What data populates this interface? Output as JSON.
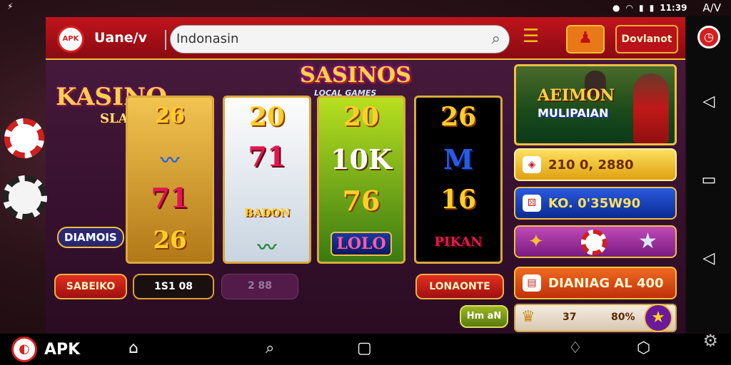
{
  "statusbar": {
    "left_icon": "usb-icon",
    "time": "11:39",
    "carrier": "A/V",
    "icons": [
      "notification-icon",
      "wifi-icon",
      "signal-icon",
      "battery-icon"
    ]
  },
  "header": {
    "logo_text": "APK",
    "app_name": "Uane/v",
    "search_value": "Indonasin",
    "download_label": "Dovlanot"
  },
  "game": {
    "title_main": "KASINO",
    "title_sub": "SLAISONS",
    "title_top": "SASINOS",
    "title_top_sub": "LOCAL GAMES",
    "diamonds_label": "DIAMOIS",
    "reels": [
      [
        "26",
        "",
        "71",
        "26"
      ],
      [
        "20",
        "71",
        "BADON",
        ""
      ],
      [
        "20",
        "10K",
        "76",
        "LOLO"
      ],
      [
        "26",
        "",
        "16",
        "PIKAN"
      ]
    ],
    "controls": [
      "SABEIKO",
      "1S1 08",
      "2 88",
      "LONAONTE"
    ],
    "hint_button": "Hm aN"
  },
  "side": {
    "banner_line1": "AEIMON",
    "banner_line2": "MULIPAIAN",
    "pill1": "210 0, 2880",
    "pill2": "KO. 0'35W90",
    "pill4": "DIANIAG  AL 400",
    "strip_b": "37",
    "strip_c": "80%"
  },
  "navbar": {
    "apk_label": "APK"
  },
  "colors": {
    "accent_red": "#c0141c",
    "gold": "#f0c040",
    "panel_purple": "#3a1232"
  }
}
